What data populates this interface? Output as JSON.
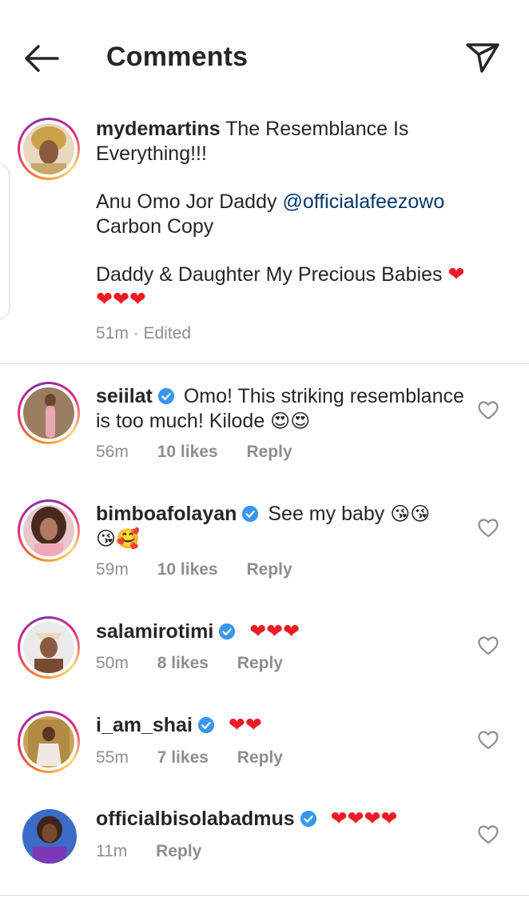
{
  "header": {
    "title": "Comments",
    "back_icon": "arrow-left-icon",
    "send_icon": "paper-plane-icon"
  },
  "caption": {
    "username": "mydemartins",
    "line1": "The Resemblance Is Everything!!!",
    "line2_prefix": "Anu Omo Jor Daddy ",
    "mention": "@officialafeezowo",
    "line2_suffix": "Carbon Copy",
    "line3": "Daddy & Daughter My Precious Babies ",
    "line3_hearts": "❤",
    "line4_hearts": "❤❤❤",
    "time": "51m",
    "edited": "Edited"
  },
  "comments": [
    {
      "username": "seiilat",
      "text": "Omo! This striking resemblance is too much! Kilode ",
      "emoji": "😍😍",
      "time": "56m",
      "likes": "10 likes",
      "reply": "Reply"
    },
    {
      "username": "bimboafolayan",
      "text": "See my baby ",
      "emoji": "😘😘",
      "emoji2": "😘🥰",
      "time": "59m",
      "likes": "10 likes",
      "reply": "Reply"
    },
    {
      "username": "salamirotimi",
      "hearts": "❤❤❤",
      "time": "50m",
      "likes": "8 likes",
      "reply": "Reply"
    },
    {
      "username": "i_am_shai",
      "hearts": "❤❤",
      "time": "55m",
      "likes": "7 likes",
      "reply": "Reply"
    },
    {
      "username": "officialbisolabadmus",
      "hearts": "❤❤❤❤",
      "time": "11m",
      "reply": "Reply"
    }
  ],
  "colors": {
    "text": "#262626",
    "secondary": "#8e8e8e",
    "mention": "#00376b",
    "verified": "#3897f0",
    "heart": "#ed1c24"
  }
}
